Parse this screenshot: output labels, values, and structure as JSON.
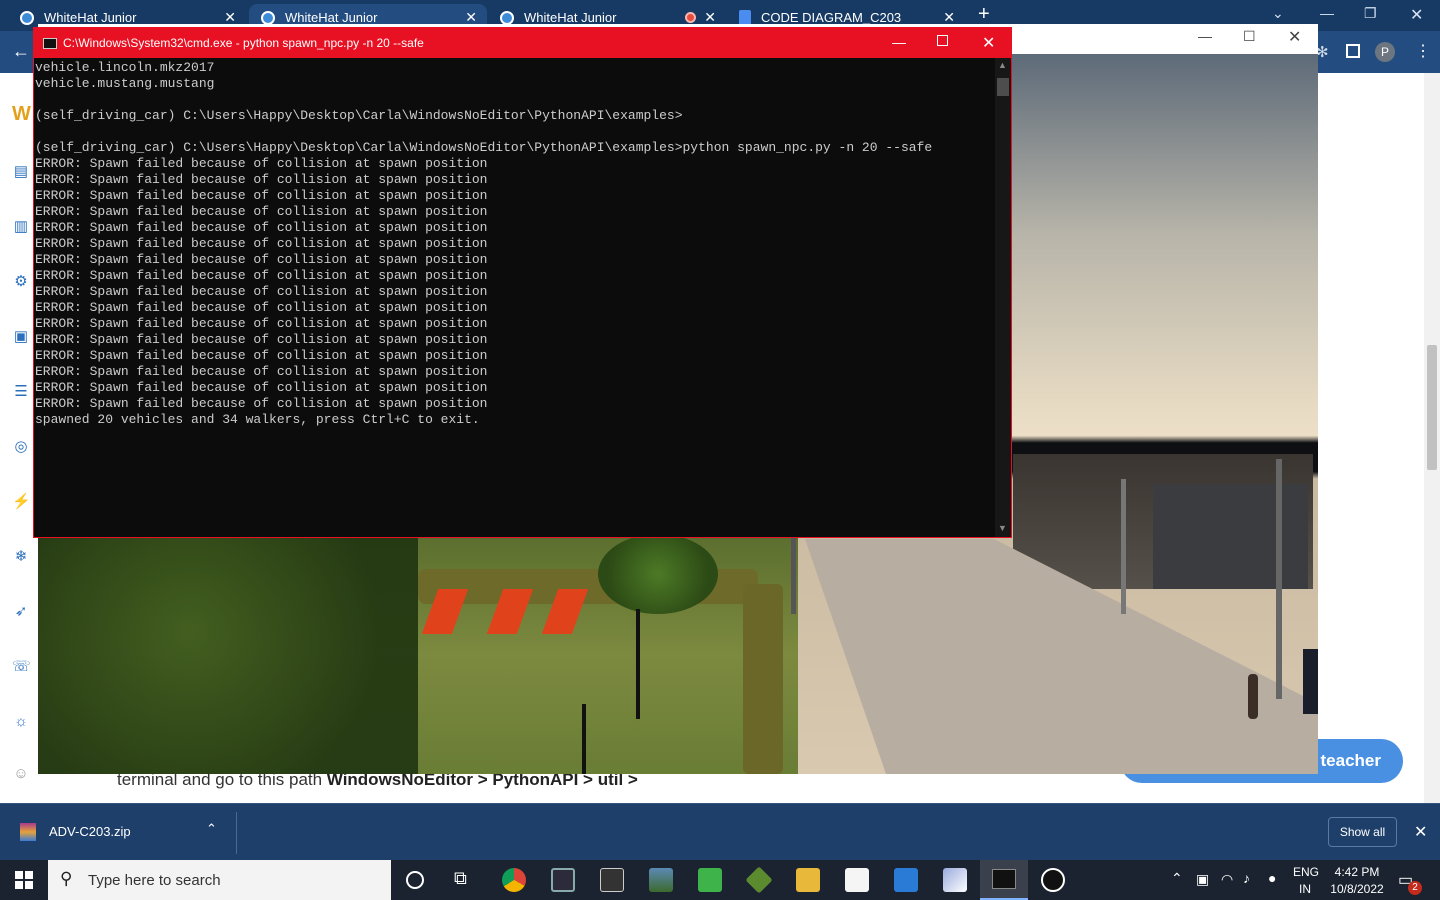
{
  "browser": {
    "tabs": [
      {
        "label": "WhiteHat Junior",
        "active": false
      },
      {
        "label": "WhiteHat Junior",
        "active": true
      },
      {
        "label": "WhiteHat Junior",
        "active": false,
        "recording": true
      },
      {
        "label": "CODE DIAGRAM_C203",
        "active": false
      }
    ],
    "new_tab": "+",
    "profile_initial": "P"
  },
  "page": {
    "instruction_prefix": "terminal and go to this path ",
    "path": "WindowsNoEditor > PythonAPI > util >",
    "teacher_button": "teacher"
  },
  "cmd": {
    "title": "C:\\Windows\\System32\\cmd.exe - python  spawn_npc.py -n 20 --safe",
    "lines": [
      "vehicle.lincoln.mkz2017",
      "vehicle.mustang.mustang",
      "",
      "(self_driving_car) C:\\Users\\Happy\\Desktop\\Carla\\WindowsNoEditor\\PythonAPI\\examples>",
      "",
      "(self_driving_car) C:\\Users\\Happy\\Desktop\\Carla\\WindowsNoEditor\\PythonAPI\\examples>python spawn_npc.py -n 20 --safe",
      "ERROR: Spawn failed because of collision at spawn position",
      "ERROR: Spawn failed because of collision at spawn position",
      "ERROR: Spawn failed because of collision at spawn position",
      "ERROR: Spawn failed because of collision at spawn position",
      "ERROR: Spawn failed because of collision at spawn position",
      "ERROR: Spawn failed because of collision at spawn position",
      "ERROR: Spawn failed because of collision at spawn position",
      "ERROR: Spawn failed because of collision at spawn position",
      "ERROR: Spawn failed because of collision at spawn position",
      "ERROR: Spawn failed because of collision at spawn position",
      "ERROR: Spawn failed because of collision at spawn position",
      "ERROR: Spawn failed because of collision at spawn position",
      "ERROR: Spawn failed because of collision at spawn position",
      "ERROR: Spawn failed because of collision at spawn position",
      "ERROR: Spawn failed because of collision at spawn position",
      "ERROR: Spawn failed because of collision at spawn position",
      "spawned 20 vehicles and 34 walkers, press Ctrl+C to exit."
    ]
  },
  "downloads": {
    "file": "ADV-C203.zip",
    "show_all": "Show all"
  },
  "taskbar": {
    "search_placeholder": "Type here to search",
    "lang_top": "ENG",
    "lang_bottom": "IN",
    "time": "4:42 PM",
    "date": "10/8/2022",
    "notifications": "2"
  },
  "colors": {
    "cmd_accent": "#e81123",
    "browser_frame": "#173a65",
    "teacher_button": "#4a90e2"
  }
}
